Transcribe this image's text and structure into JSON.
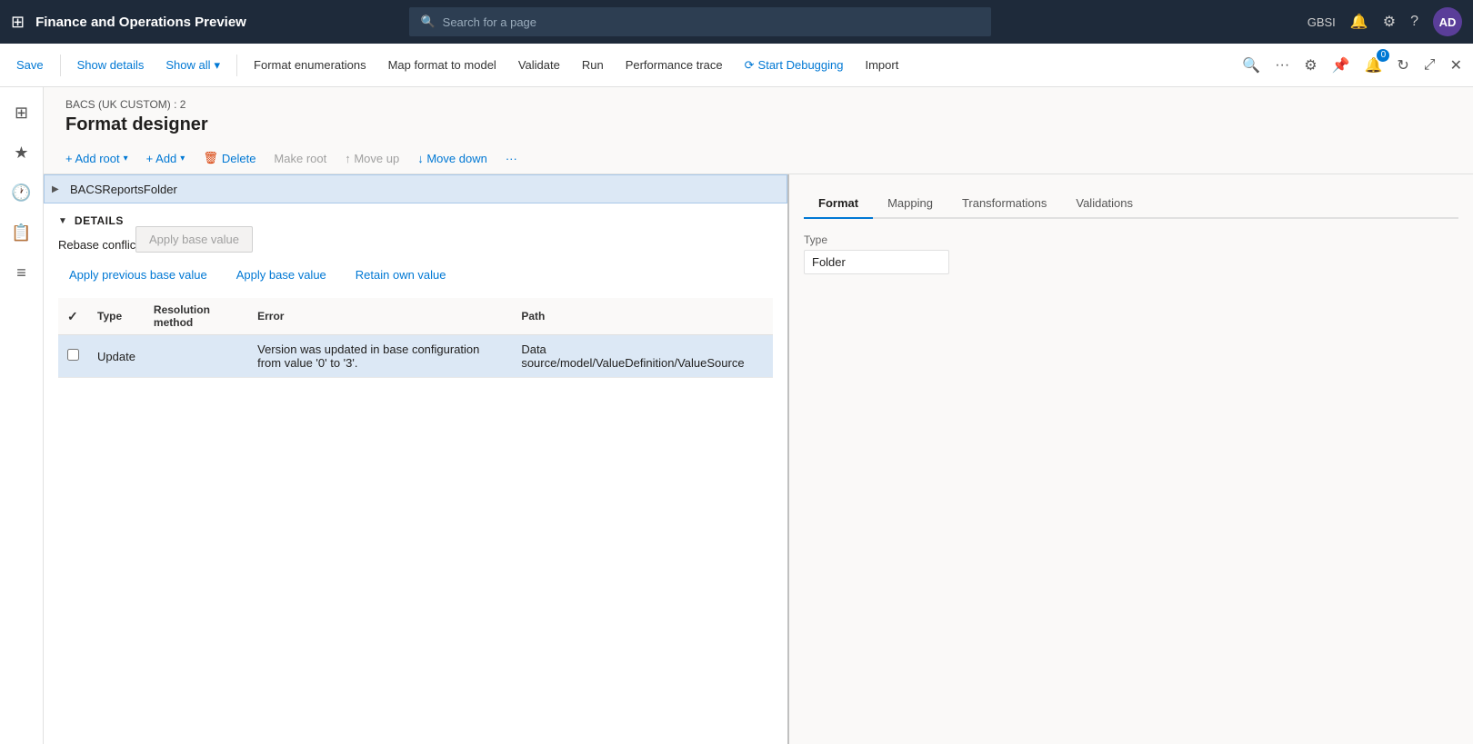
{
  "topBar": {
    "gridIcon": "⊞",
    "title": "Finance and Operations Preview",
    "search": {
      "placeholder": "Search for a page",
      "icon": "🔍"
    },
    "userCode": "GBSI",
    "userAvatar": "AD",
    "icons": {
      "bell": "🔔",
      "gear": "⚙",
      "help": "?"
    }
  },
  "toolbar": {
    "save": "Save",
    "showDetails": "Show details",
    "showAll": "Show all",
    "formatEnumerations": "Format enumerations",
    "mapFormatToModel": "Map format to model",
    "validate": "Validate",
    "run": "Run",
    "performanceTrace": "Performance trace",
    "startDebugging": "Start Debugging",
    "import": "Import"
  },
  "leftSidebar": {
    "icons": [
      "⊞",
      "★",
      "🕐",
      "📋",
      "≡"
    ]
  },
  "pageHeader": {
    "breadcrumb": "BACS (UK CUSTOM) : 2",
    "title": "Format designer"
  },
  "formatToolbar": {
    "addRoot": "+ Add root",
    "add": "+ Add",
    "delete": "Delete",
    "makeRoot": "Make root",
    "moveUp": "↑ Move up",
    "moveDown": "↓ Move down",
    "more": "···"
  },
  "tabs": {
    "items": [
      "Format",
      "Mapping",
      "Transformations",
      "Validations"
    ],
    "active": 0
  },
  "tree": {
    "item": "BACSReportsFolder"
  },
  "properties": {
    "typeLabel": "Type",
    "typeValue": "Folder"
  },
  "details": {
    "title": "DETAILS",
    "rebaseConflicts": "Rebase conflicts (1)",
    "applyPreviousBaseValue": "Apply previous base value",
    "applyBaseValue": "Apply base value",
    "retainOwnValue": "Retain own value",
    "applyBaseValuePopup": "Apply base value"
  },
  "table": {
    "columns": [
      "Resolved",
      "Type",
      "Resolution method",
      "Error",
      "Path"
    ],
    "rows": [
      {
        "resolved": false,
        "type": "Update",
        "resolutionMethod": "",
        "error": "Version was updated in base configuration from value '0' to '3'.",
        "path": "Data source/model/ValueDefinition/ValueSource"
      }
    ]
  }
}
